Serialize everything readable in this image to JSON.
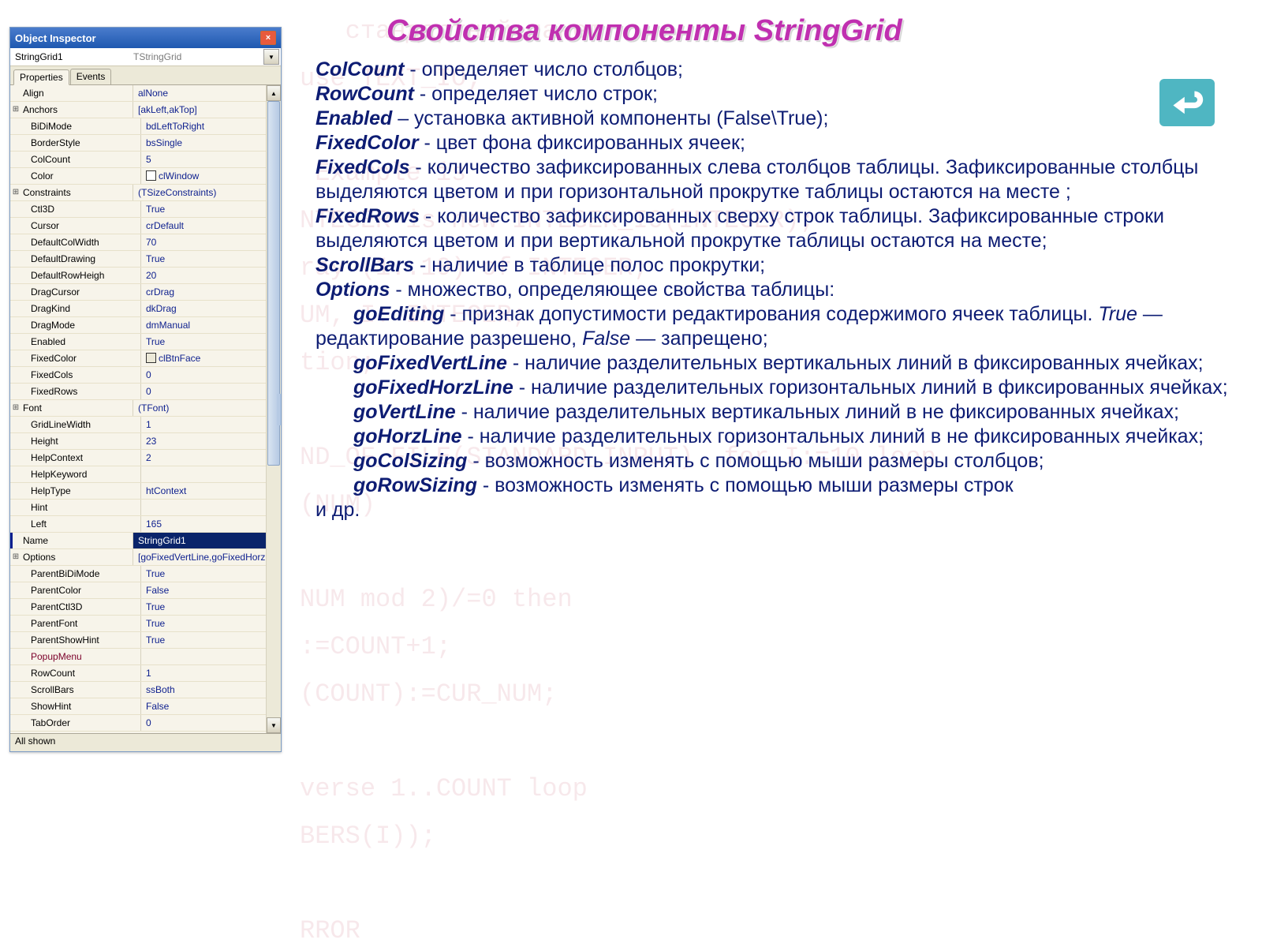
{
  "title_main": "Свойства компоненты ",
  "title_em": "StringGrid",
  "bg_code": "   стандартный пакет\nuse TEXT_IO;\n\n Example is\nNTEGER is new INTEGER_IO(INTEGER);\nray (1..10) of INTEGER;\nUM, I: INTEGER;\ntion;\n\nND_OF_FILE(STANDARD_INPUT)  for I:=10 loop\n(NUM)\n\nNUM mod 2)/=0 then\n:=COUNT+1;\n(COUNT):=CUR_NUM;\n\nverse 1..COUNT loop\nBERS(I));\n\nRROR\n ерный формат числа в строке\nROR ;\n   ATLB_Example",
  "return_btn_name": "return-button",
  "inspector": {
    "window_title": "Object Inspector",
    "instance": "StringGrid1",
    "class": "TStringGrid",
    "tabs": {
      "props": "Properties",
      "events": "Events"
    },
    "status": "All shown",
    "rows": [
      {
        "label": "Align",
        "value": "alNone",
        "expand": false
      },
      {
        "label": "Anchors",
        "value": "[akLeft,akTop]",
        "expand": true
      },
      {
        "label": "BiDiMode",
        "value": "bdLeftToRight",
        "indent": true
      },
      {
        "label": "BorderStyle",
        "value": "bsSingle",
        "indent": true
      },
      {
        "label": "ColCount",
        "value": "5",
        "indent": true
      },
      {
        "label": "Color",
        "value": "clWindow",
        "indent": true,
        "swatch": "white"
      },
      {
        "label": "Constraints",
        "value": "(TSizeConstraints)",
        "expand": true
      },
      {
        "label": "Ctl3D",
        "value": "True",
        "indent": true
      },
      {
        "label": "Cursor",
        "value": "crDefault",
        "indent": true
      },
      {
        "label": "DefaultColWidth",
        "value": "70",
        "indent": true
      },
      {
        "label": "DefaultDrawing",
        "value": "True",
        "indent": true
      },
      {
        "label": "DefaultRowHeigh",
        "value": "20",
        "indent": true
      },
      {
        "label": "DragCursor",
        "value": "crDrag",
        "indent": true
      },
      {
        "label": "DragKind",
        "value": "dkDrag",
        "indent": true
      },
      {
        "label": "DragMode",
        "value": "dmManual",
        "indent": true
      },
      {
        "label": "Enabled",
        "value": "True",
        "indent": true
      },
      {
        "label": "FixedColor",
        "value": "clBtnFace",
        "indent": true,
        "swatch": "btnface"
      },
      {
        "label": "FixedCols",
        "value": "0",
        "indent": true
      },
      {
        "label": "FixedRows",
        "value": "0",
        "indent": true
      },
      {
        "label": "Font",
        "value": "(TFont)",
        "expand": true
      },
      {
        "label": "GridLineWidth",
        "value": "1",
        "indent": true
      },
      {
        "label": "Height",
        "value": "23",
        "indent": true
      },
      {
        "label": "HelpContext",
        "value": "2",
        "indent": true
      },
      {
        "label": "HelpKeyword",
        "value": "",
        "indent": true
      },
      {
        "label": "HelpType",
        "value": "htContext",
        "indent": true
      },
      {
        "label": "Hint",
        "value": "",
        "indent": true
      },
      {
        "label": "Left",
        "value": "165",
        "indent": true
      },
      {
        "label": "Name",
        "value": "StringGrid1",
        "indent": true,
        "selected": true
      },
      {
        "label": "Options",
        "value": "[goFixedVertLine,goFixedHorz",
        "expand": true
      },
      {
        "label": "ParentBiDiMode",
        "value": "True",
        "indent": true
      },
      {
        "label": "ParentColor",
        "value": "False",
        "indent": true
      },
      {
        "label": "ParentCtl3D",
        "value": "True",
        "indent": true
      },
      {
        "label": "ParentFont",
        "value": "True",
        "indent": true
      },
      {
        "label": "ParentShowHint",
        "value": "True",
        "indent": true
      },
      {
        "label": "PopupMenu",
        "value": "",
        "indent": true,
        "maroon": true
      },
      {
        "label": "RowCount",
        "value": "1",
        "indent": true
      },
      {
        "label": "ScrollBars",
        "value": "ssBoth",
        "indent": true
      },
      {
        "label": "ShowHint",
        "value": "False",
        "indent": true
      },
      {
        "label": "TabOrder",
        "value": "0",
        "indent": true
      }
    ]
  },
  "desc": {
    "colcount_k": "ColCount",
    "colcount_t": " - определяет число столбцов;",
    "rowcount_k": "RowCount",
    "rowcount_t": " - определяет число строк;",
    "enabled_k": "Enabled",
    "enabled_t": " – установка активной компоненты (False\\True);",
    "fixedcolor_k": "FixedColor",
    "fixedcolor_t": " - цвет фона фиксированных ячеек;",
    "fixedcols_k": "FixedCols",
    "fixedcols_t": " - количество зафиксированных слева столбцов таблицы. Зафиксированные столбцы выделяются цветом и при горизонтальной прокрутке таблицы остаются на месте ;",
    "fixedrows_k": "FixedRows",
    "fixedrows_t": " - количество зафиксированных сверху строк таблицы. Зафиксированные строки выделяются цветом и при вертикальной прокрутке таблицы остаются на месте;",
    "scrollbars_k": "ScrollBars",
    "scrollbars_t": " - наличие в таблице полос прокрутки;",
    "options_k": "Options",
    "options_t": " - множество, определяющее свойства таблицы:",
    "goedit_k": "goEditing",
    "goedit_t1": " - признак допустимости редактирования содержимого ячеек таблицы. ",
    "goedit_true": "True",
    "goedit_mid": " — редактирование разрешено, ",
    "goedit_false": "False",
    "goedit_end": " — запрещено;",
    "gofvl_k": "goFixedVertLine",
    "gofvl_t": " - наличие разделительных вертикальных линий в фиксированных ячейках;",
    "gofhl_k": "goFixedHorzLine",
    "gofhl_t": " - наличие разделительных горизонтальных линий в фиксированных ячейках;",
    "govl_k": "goVertLine",
    "govl_t": " - наличие разделительных вертикальных линий в не фиксированных ячейках;",
    "gohl_k": "goHorzLine",
    "gohl_t": " - наличие разделительных горизонтальных линий в не фиксированных ячейках;",
    "gocs_k": "goColSizing",
    "gocs_t": " - возможность изменять с помощью мыши размеры столбцов;",
    "gors_k": "goRowSizing",
    "gors_t": " - возможность изменять с помощью мыши размеры строк",
    "etc": "и др."
  }
}
